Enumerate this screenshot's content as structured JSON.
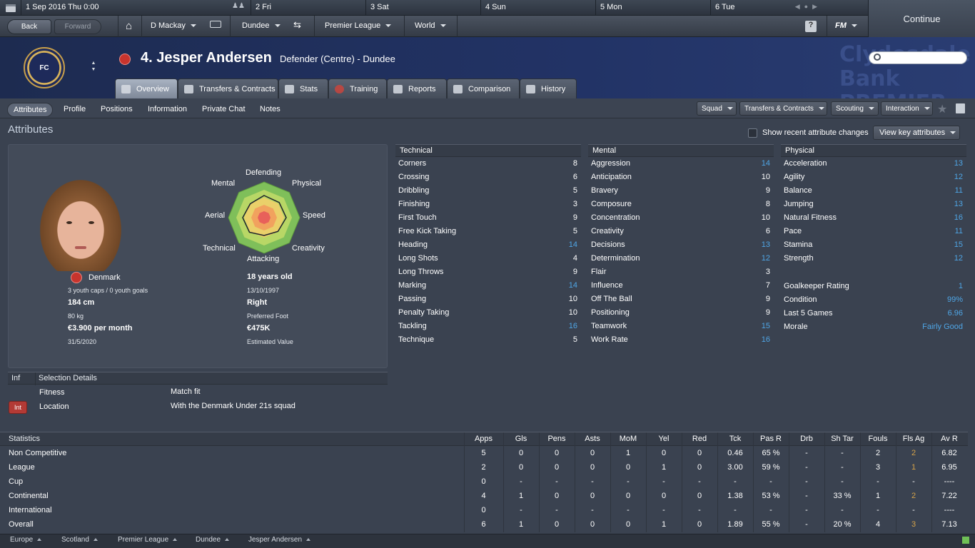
{
  "calendar": {
    "current": "1 Sep 2016  Thu 0:00",
    "days": [
      "2 Fri",
      "3 Sat",
      "4 Sun",
      "5 Mon",
      "6 Tue"
    ]
  },
  "continue_label": "Continue",
  "nav": {
    "back": "Back",
    "forward": "Forward",
    "manager": "D Mackay",
    "club": "Dundee",
    "competition": "Premier League",
    "world": "World",
    "help": "?",
    "fm": "FM"
  },
  "header": {
    "crest_text": "FC",
    "player_name": "4. Jesper Andersen",
    "role": "Defender (Centre) - Dundee",
    "sponsor_text": "Clydesdale Bank PREMIER LEAGUE"
  },
  "tabs": [
    "Overview",
    "Transfers & Contracts",
    "Stats",
    "Training",
    "Reports",
    "Comparison",
    "History"
  ],
  "subtabs": [
    "Attributes",
    "Profile",
    "Positions",
    "Information",
    "Private Chat",
    "Notes"
  ],
  "right_menus": [
    "Squad",
    "Transfers & Contracts",
    "Scouting",
    "Interaction"
  ],
  "section_title": "Attributes",
  "show_recent_label": "Show recent attribute changes",
  "view_key_label": "View key attributes",
  "player": {
    "nationality": "Denmark",
    "caps": "3 youth caps / 0 youth goals",
    "height": "184 cm",
    "weight": "80 kg",
    "wage": "€3.900 per month",
    "contract_end": "31/5/2020",
    "age": "18 years old",
    "dob": "13/10/1997",
    "foot": "Right",
    "foot_label": "Preferred Foot",
    "value": "€475K",
    "value_label": "Estimated Value"
  },
  "web_labels": {
    "defending": "Defending",
    "physical": "Physical",
    "speed": "Speed",
    "creativity": "Creativity",
    "attacking": "Attacking",
    "technical": "Technical",
    "aerial": "Aerial",
    "mental": "Mental"
  },
  "web_values": [
    0.62,
    0.6,
    0.62,
    0.55,
    0.5,
    0.58,
    0.6,
    0.55
  ],
  "technical": {
    "title": "Technical",
    "rows": [
      {
        "name": "Corners",
        "value": "8"
      },
      {
        "name": "Crossing",
        "value": "6"
      },
      {
        "name": "Dribbling",
        "value": "5"
      },
      {
        "name": "Finishing",
        "value": "3"
      },
      {
        "name": "First Touch",
        "value": "9"
      },
      {
        "name": "Free Kick Taking",
        "value": "5"
      },
      {
        "name": "Heading",
        "value": "14"
      },
      {
        "name": "Long Shots",
        "value": "4"
      },
      {
        "name": "Long Throws",
        "value": "9"
      },
      {
        "name": "Marking",
        "value": "14"
      },
      {
        "name": "Passing",
        "value": "10"
      },
      {
        "name": "Penalty Taking",
        "value": "10"
      },
      {
        "name": "Tackling",
        "value": "16"
      },
      {
        "name": "Technique",
        "value": "5"
      }
    ]
  },
  "mental": {
    "title": "Mental",
    "rows": [
      {
        "name": "Aggression",
        "value": "14"
      },
      {
        "name": "Anticipation",
        "value": "10"
      },
      {
        "name": "Bravery",
        "value": "9"
      },
      {
        "name": "Composure",
        "value": "8"
      },
      {
        "name": "Concentration",
        "value": "10"
      },
      {
        "name": "Creativity",
        "value": "6"
      },
      {
        "name": "Decisions",
        "value": "13"
      },
      {
        "name": "Determination",
        "value": "12"
      },
      {
        "name": "Flair",
        "value": "3"
      },
      {
        "name": "Influence",
        "value": "7"
      },
      {
        "name": "Off The Ball",
        "value": "9"
      },
      {
        "name": "Positioning",
        "value": "9"
      },
      {
        "name": "Teamwork",
        "value": "15"
      },
      {
        "name": "Work Rate",
        "value": "16"
      }
    ]
  },
  "physical": {
    "title": "Physical",
    "rows": [
      {
        "name": "Acceleration",
        "value": "13"
      },
      {
        "name": "Agility",
        "value": "12"
      },
      {
        "name": "Balance",
        "value": "11"
      },
      {
        "name": "Jumping",
        "value": "13"
      },
      {
        "name": "Natural Fitness",
        "value": "16"
      },
      {
        "name": "Pace",
        "value": "11"
      },
      {
        "name": "Stamina",
        "value": "15"
      },
      {
        "name": "Strength",
        "value": "12"
      }
    ],
    "extra": [
      {
        "name": "Goalkeeper Rating",
        "value": "1"
      },
      {
        "name": "Condition",
        "value": "99%"
      },
      {
        "name": "Last 5 Games",
        "value": "6.96"
      },
      {
        "name": "Morale",
        "value": "Fairly Good"
      }
    ]
  },
  "selection": {
    "col1": "Inf",
    "col2": "Selection Details",
    "fitness_label": "Fitness",
    "fitness_value": "Match fit",
    "badge": "Int",
    "location_label": "Location",
    "location_value": "With the Denmark Under 21s squad"
  },
  "stats": {
    "title": "Statistics",
    "columns": [
      "Apps",
      "Gls",
      "Pens",
      "Asts",
      "MoM",
      "Yel",
      "Red",
      "Tck",
      "Pas R",
      "Drb",
      "Sh Tar",
      "Fouls",
      "Fls Ag",
      "Av R"
    ],
    "rows": [
      {
        "label": "Non Competitive",
        "cells": [
          "5",
          "0",
          "0",
          "0",
          "1",
          "0",
          "0",
          "0.46",
          "65 %",
          "-",
          "-",
          "2",
          "2",
          "6.82"
        ]
      },
      {
        "label": "League",
        "cells": [
          "2",
          "0",
          "0",
          "0",
          "0",
          "1",
          "0",
          "3.00",
          "59 %",
          "-",
          "-",
          "3",
          "1",
          "6.95"
        ]
      },
      {
        "label": "Cup",
        "cells": [
          "0",
          "-",
          "-",
          "-",
          "-",
          "-",
          "-",
          "-",
          "-",
          "-",
          "-",
          "-",
          "-",
          "----"
        ]
      },
      {
        "label": "Continental",
        "cells": [
          "4",
          "1",
          "0",
          "0",
          "0",
          "0",
          "0",
          "1.38",
          "53 %",
          "-",
          "33 %",
          "1",
          "2",
          "7.22"
        ]
      },
      {
        "label": "International",
        "cells": [
          "0",
          "-",
          "-",
          "-",
          "-",
          "-",
          "-",
          "-",
          "-",
          "-",
          "-",
          "-",
          "-",
          "----"
        ]
      },
      {
        "label": "Overall",
        "cells": [
          "6",
          "1",
          "0",
          "0",
          "0",
          "1",
          "0",
          "1.89",
          "55 %",
          "-",
          "20 %",
          "4",
          "3",
          "7.13"
        ]
      }
    ]
  },
  "breadcrumbs": [
    "Europe",
    "Scotland",
    "Premier League",
    "Dundee",
    "Jesper Andersen"
  ],
  "colors": {
    "highlight": "#4fa6e6",
    "gold": "#d6a34a",
    "header": "#223366"
  }
}
